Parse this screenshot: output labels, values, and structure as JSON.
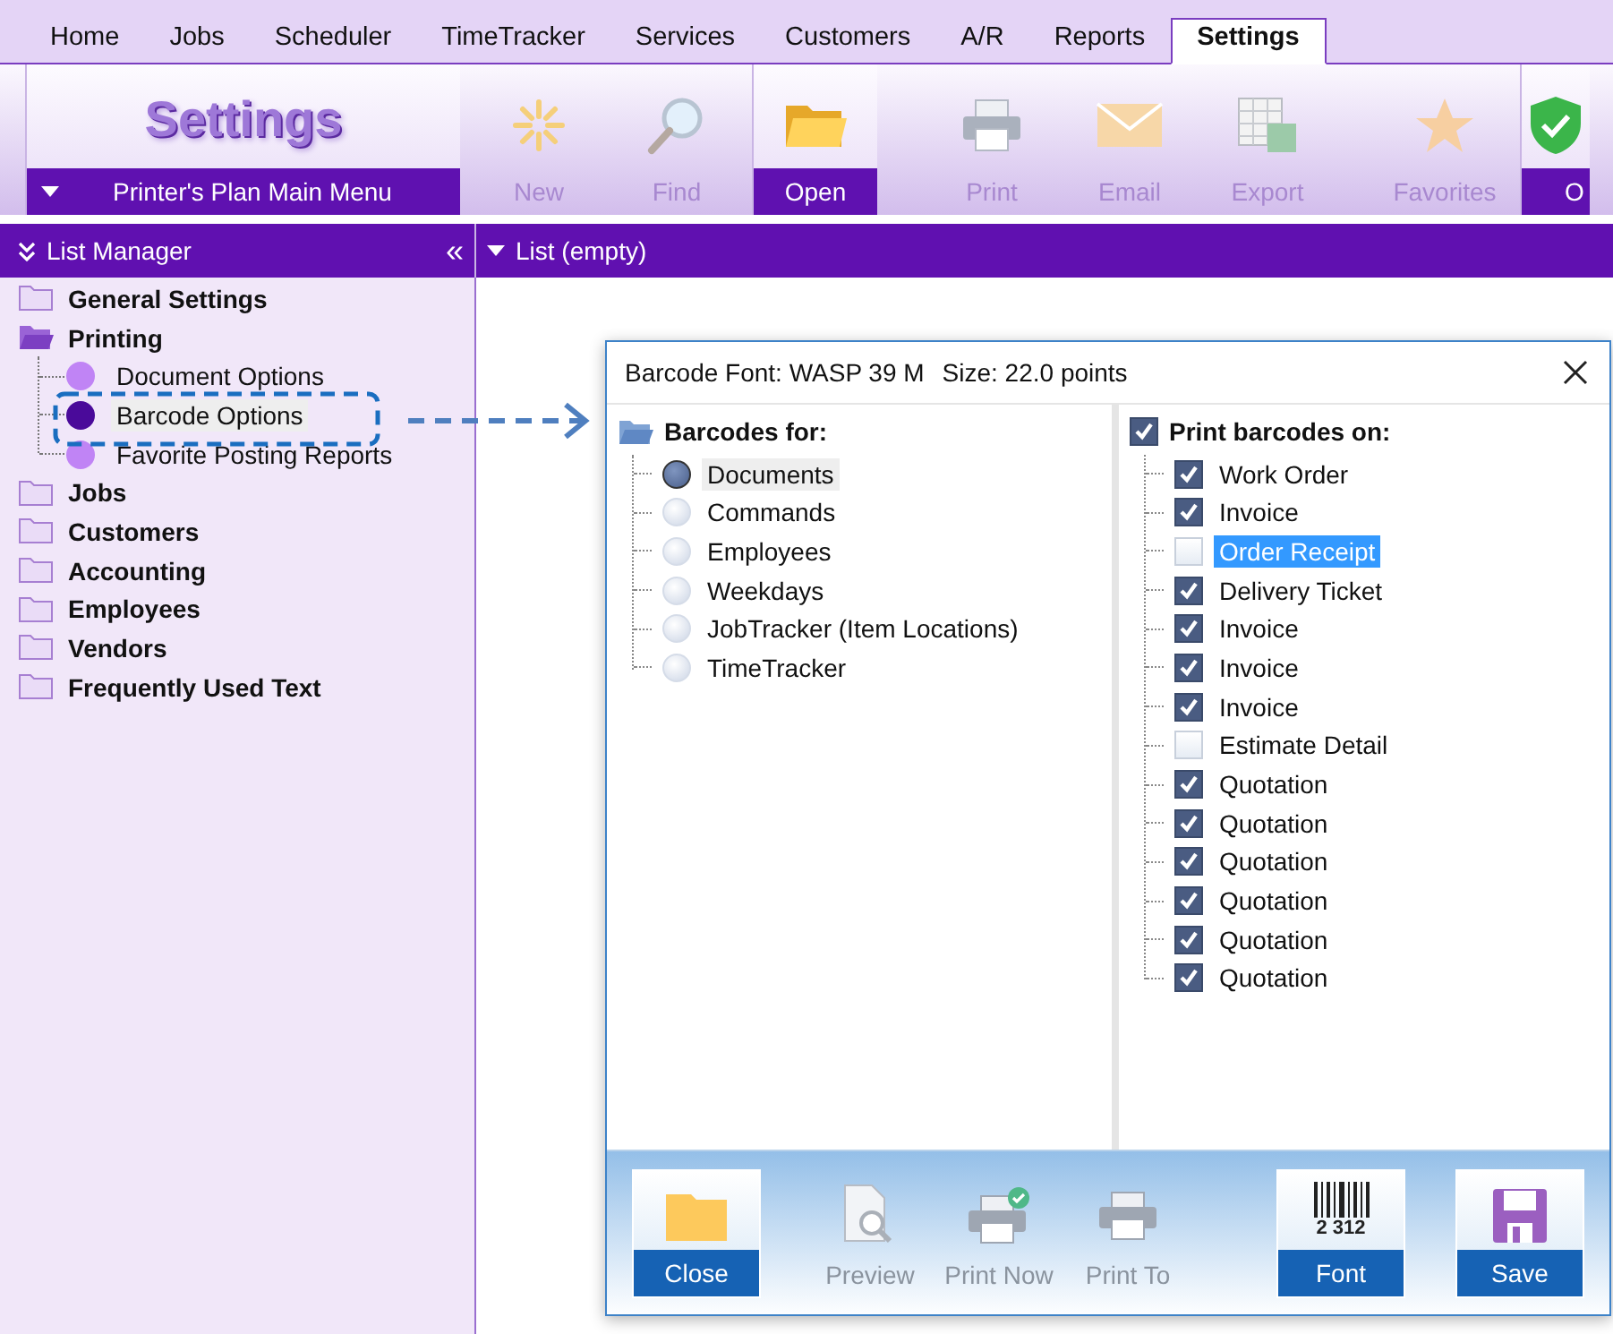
{
  "tabs": [
    {
      "label": "Home",
      "selected": false
    },
    {
      "label": "Jobs",
      "selected": false
    },
    {
      "label": "Scheduler",
      "selected": false
    },
    {
      "label": "TimeTracker",
      "selected": false
    },
    {
      "label": "Services",
      "selected": false
    },
    {
      "label": "Customers",
      "selected": false
    },
    {
      "label": "A/R",
      "selected": false
    },
    {
      "label": "Reports",
      "selected": false
    },
    {
      "label": "Settings",
      "selected": true
    }
  ],
  "module": {
    "title": "Settings",
    "menu": "Printer's Plan Main Menu"
  },
  "toolbar": [
    {
      "label": "New",
      "kind": "new",
      "disabled": true
    },
    {
      "label": "Find",
      "kind": "find",
      "disabled": true
    },
    {
      "label": "Open",
      "kind": "open",
      "disabled": false
    },
    {
      "label": "Print",
      "kind": "print",
      "disabled": true
    },
    {
      "label": "Email",
      "kind": "email",
      "disabled": true
    },
    {
      "label": "Export",
      "kind": "export",
      "disabled": true
    },
    {
      "label": "Favorites",
      "kind": "favorites",
      "disabled": true
    },
    {
      "label": "O",
      "kind": "shield",
      "disabled": false
    }
  ],
  "list_manager": {
    "title": "List Manager",
    "collapse": "«"
  },
  "list_header": {
    "title": "List (empty)"
  },
  "sidebar": {
    "items": [
      {
        "label": "General Settings",
        "expanded": false
      },
      {
        "label": "Printing",
        "expanded": true,
        "children": [
          {
            "label": "Document Options",
            "selected": false
          },
          {
            "label": "Barcode Options",
            "selected": true
          },
          {
            "label": "Favorite Posting Reports",
            "selected": false
          }
        ]
      },
      {
        "label": "Jobs",
        "expanded": false
      },
      {
        "label": "Customers",
        "expanded": false
      },
      {
        "label": "Accounting",
        "expanded": false
      },
      {
        "label": "Employees",
        "expanded": false
      },
      {
        "label": "Vendors",
        "expanded": false
      },
      {
        "label": "Frequently Used Text",
        "expanded": false
      }
    ]
  },
  "dialog": {
    "title": "Barcode Font: WASP 39 M",
    "size": "Size: 22.0 points",
    "barcodes_for": {
      "label": "Barcodes for:",
      "options": [
        {
          "label": "Documents",
          "selected": true
        },
        {
          "label": "Commands",
          "selected": false
        },
        {
          "label": "Employees",
          "selected": false
        },
        {
          "label": "Weekdays",
          "selected": false
        },
        {
          "label": "JobTracker (Item Locations)",
          "selected": false
        },
        {
          "label": "TimeTracker",
          "selected": false
        }
      ]
    },
    "print_barcodes_on": {
      "label": "Print barcodes on:",
      "checked": true,
      "items": [
        {
          "label": "Work Order",
          "checked": true,
          "selected": false
        },
        {
          "label": "Invoice",
          "checked": true,
          "selected": false
        },
        {
          "label": "Order Receipt",
          "checked": false,
          "selected": true
        },
        {
          "label": "Delivery Ticket",
          "checked": true,
          "selected": false
        },
        {
          "label": "Invoice",
          "checked": true,
          "selected": false
        },
        {
          "label": "Invoice",
          "checked": true,
          "selected": false
        },
        {
          "label": "Invoice",
          "checked": true,
          "selected": false
        },
        {
          "label": "Estimate Detail",
          "checked": false,
          "selected": false
        },
        {
          "label": "Quotation",
          "checked": true,
          "selected": false
        },
        {
          "label": "Quotation",
          "checked": true,
          "selected": false
        },
        {
          "label": "Quotation",
          "checked": true,
          "selected": false
        },
        {
          "label": "Quotation",
          "checked": true,
          "selected": false
        },
        {
          "label": "Quotation",
          "checked": true,
          "selected": false
        },
        {
          "label": "Quotation",
          "checked": true,
          "selected": false
        }
      ]
    },
    "buttons": [
      {
        "label": "Close",
        "kind": "close",
        "disabled": false
      },
      {
        "label": "Preview",
        "kind": "preview",
        "disabled": true
      },
      {
        "label": "Print Now",
        "kind": "print_now",
        "disabled": true
      },
      {
        "label": "Print To",
        "kind": "print_to",
        "disabled": true
      },
      {
        "label": "Font",
        "kind": "font",
        "disabled": false,
        "caption": "2 312"
      },
      {
        "label": "Save",
        "kind": "save",
        "disabled": false
      }
    ]
  }
}
